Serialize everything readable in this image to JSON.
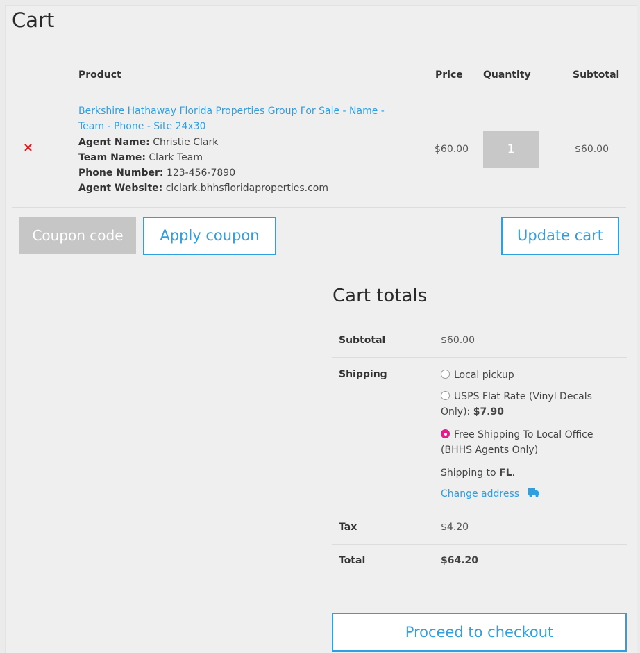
{
  "page": {
    "title": "Cart"
  },
  "table": {
    "headers": {
      "product": "Product",
      "price": "Price",
      "quantity": "Quantity",
      "subtotal": "Subtotal"
    },
    "row": {
      "remove_glyph": "×",
      "product_name": "Berkshire Hathaway Florida Properties Group For Sale - Name - Team - Phone - Site 24x30",
      "meta": [
        {
          "label": "Agent Name:",
          "value": "Christie Clark"
        },
        {
          "label": "Team Name:",
          "value": "Clark Team"
        },
        {
          "label": "Phone Number:",
          "value": "123-456-7890"
        },
        {
          "label": "Agent Website:",
          "value": "clclark.bhhsfloridaproperties.com"
        }
      ],
      "price": "$60.00",
      "quantity": "1",
      "subtotal": "$60.00"
    }
  },
  "actions": {
    "coupon_placeholder": "Coupon code",
    "apply_coupon": "Apply coupon",
    "update_cart": "Update cart"
  },
  "totals": {
    "title": "Cart totals",
    "subtotal_label": "Subtotal",
    "subtotal_value": "$60.00",
    "shipping_label": "Shipping",
    "shipping_options": [
      {
        "label": "Local pickup",
        "price": "",
        "selected": false
      },
      {
        "label": "USPS Flat Rate (Vinyl Decals Only):",
        "price": "$7.90",
        "selected": false
      },
      {
        "label": "Free Shipping To Local Office (BHHS Agents Only)",
        "price": "",
        "selected": true
      }
    ],
    "shipping_to_prefix": "Shipping to",
    "shipping_to_state": "FL",
    "shipping_to_suffix": ".",
    "change_address": "Change address",
    "tax_label": "Tax",
    "tax_value": "$4.20",
    "total_label": "Total",
    "total_value": "$64.20"
  },
  "checkout": {
    "label": "Proceed to checkout"
  },
  "colors": {
    "link": "#2f9fe0",
    "remove": "#e4161b",
    "selected_radio": "#e8198b"
  },
  "icons": {
    "remove": "close-icon",
    "change_address": "truck-icon"
  }
}
